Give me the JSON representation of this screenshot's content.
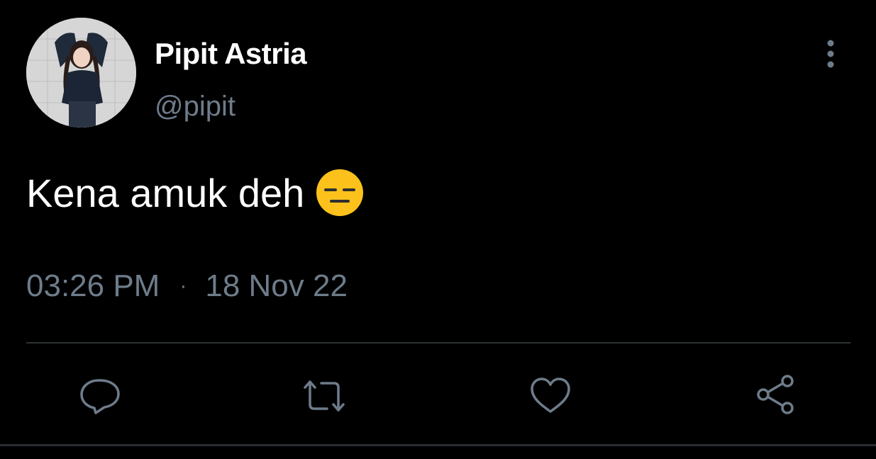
{
  "author": {
    "display_name": "Pipit Astria",
    "handle": "@pipit",
    "avatar_icon": "user-avatar-photo"
  },
  "tweet": {
    "text": "Kena amuk deh",
    "emoji": "expressionless-face-emoji",
    "time": "03:26 PM",
    "separator": "·",
    "date": "18 Nov 22"
  },
  "actions": [
    {
      "name": "reply",
      "icon": "comment-icon"
    },
    {
      "name": "retweet",
      "icon": "retweet-icon"
    },
    {
      "name": "like",
      "icon": "heart-icon"
    },
    {
      "name": "share",
      "icon": "share-icon"
    }
  ],
  "colors": {
    "background": "#000000",
    "primary_text": "#ffffff",
    "secondary_text": "#6e7c8a",
    "icon": "#6e7c8a",
    "divider": "#2f3336",
    "emoji_yellow": "#fcc21b"
  }
}
